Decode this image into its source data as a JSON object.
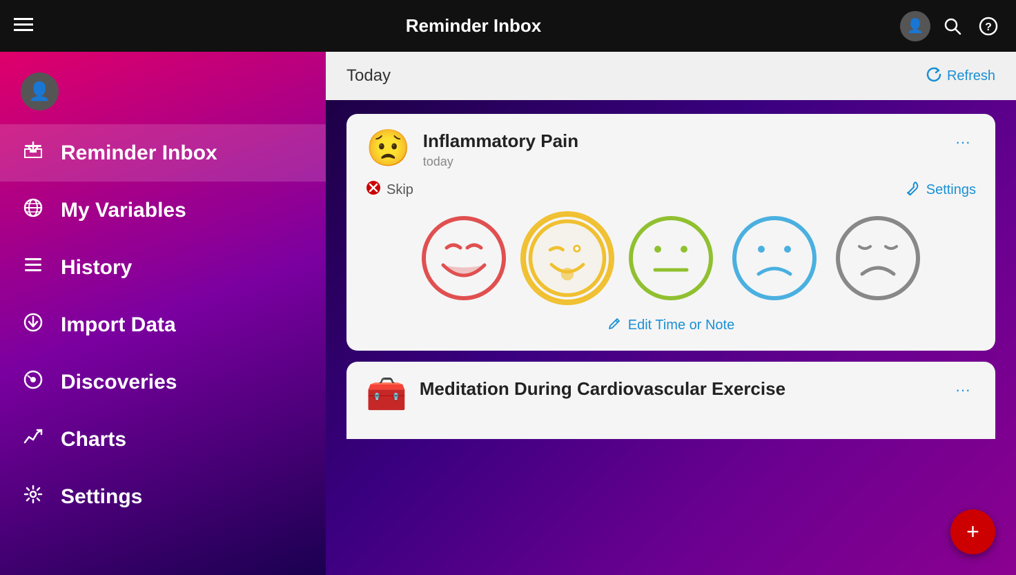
{
  "header": {
    "menu_icon": "≡",
    "title": "Reminder Inbox",
    "search_icon": "⌕",
    "help_icon": "?"
  },
  "sidebar": {
    "items": [
      {
        "id": "reminder-inbox",
        "label": "Reminder Inbox",
        "icon": "⬇",
        "icon_name": "inbox-icon",
        "active": true
      },
      {
        "id": "my-variables",
        "label": "My Variables",
        "icon": "🌐",
        "icon_name": "globe-icon",
        "active": false
      },
      {
        "id": "history",
        "label": "History",
        "icon": "☰",
        "icon_name": "history-icon",
        "active": false
      },
      {
        "id": "import-data",
        "label": "Import Data",
        "icon": "⬇",
        "icon_name": "import-icon",
        "active": false
      },
      {
        "id": "discoveries",
        "label": "Discoveries",
        "icon": "📈",
        "icon_name": "discoveries-icon",
        "active": false
      },
      {
        "id": "charts",
        "label": "Charts",
        "icon": "↗",
        "icon_name": "charts-icon",
        "active": false
      },
      {
        "id": "settings",
        "label": "Settings",
        "icon": "⚙",
        "icon_name": "settings-icon",
        "active": false
      }
    ]
  },
  "content": {
    "today_label": "Today",
    "refresh_label": "Refresh",
    "cards": [
      {
        "id": "inflammatory-pain",
        "emoji": "😟",
        "title": "Inflammatory Pain",
        "subtitle": "today",
        "skip_label": "Skip",
        "settings_label": "Settings",
        "edit_label": "Edit Time or Note",
        "moods": [
          {
            "id": "great",
            "color": "#e05050",
            "border": "#e05050",
            "label": "great"
          },
          {
            "id": "good",
            "color": "#f0c030",
            "border": "#f0c030",
            "label": "good"
          },
          {
            "id": "okay",
            "color": "#90c030",
            "border": "#90c030",
            "label": "okay"
          },
          {
            "id": "bad",
            "color": "#4ab0e0",
            "border": "#4ab0e0",
            "label": "bad"
          },
          {
            "id": "terrible",
            "color": "#888",
            "border": "#888",
            "label": "terrible"
          }
        ]
      },
      {
        "id": "meditation-cardiovascular",
        "emoji": "🧰",
        "title": "Meditation During Cardiovascular Exercise",
        "subtitle": ""
      }
    ]
  },
  "fab": {
    "label": "+"
  }
}
